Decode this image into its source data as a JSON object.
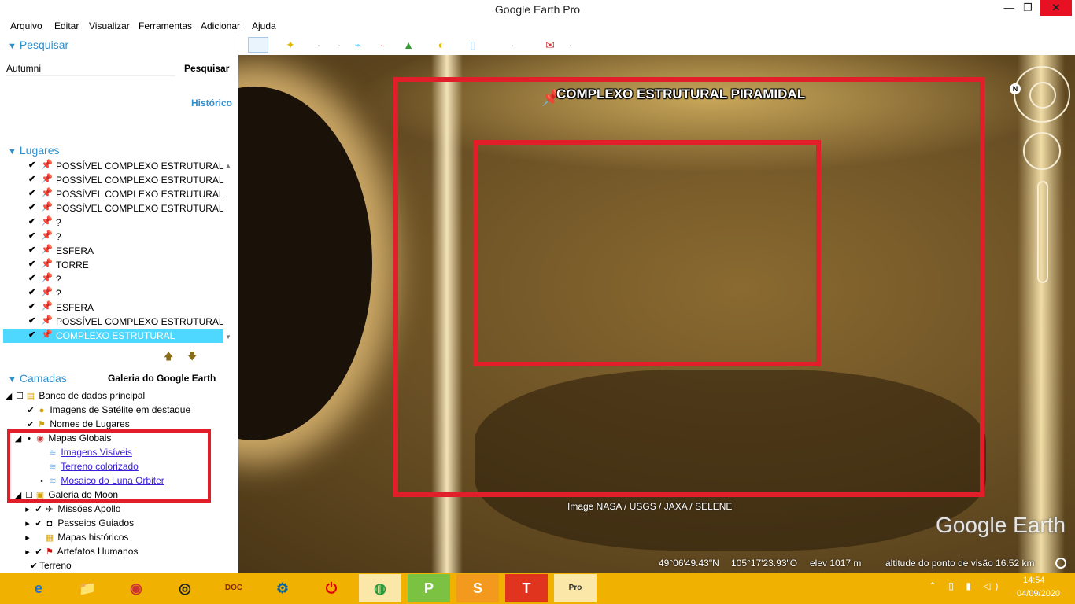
{
  "window": {
    "title": "Google Earth Pro",
    "min": "—",
    "max": "❐",
    "close": "✕"
  },
  "menu": [
    "Arquivo",
    "Editar",
    "Visualizar",
    "Ferramentas",
    "Adicionar",
    "Ajuda"
  ],
  "search": {
    "header": "Pesquisar",
    "input_value": "Autumni",
    "button_label": "Pesquisar",
    "history_label": "Histórico"
  },
  "places": {
    "header": "Lugares",
    "items": [
      "POSSÍVEL COMPLEXO ESTRUTURAL",
      "POSSÍVEL COMPLEXO ESTRUTURAL",
      "POSSÍVEL COMPLEXO ESTRUTURAL",
      "POSSÍVEL COMPLEXO ESTRUTURAL",
      "?",
      "?",
      "ESFERA",
      "TORRE",
      "?",
      "?",
      "ESFERA",
      "POSSÍVEL COMPLEXO ESTRUTURAL",
      "COMPLEXO ESTRUTURAL PIRAMIDAL"
    ],
    "selected_index": 12
  },
  "layers": {
    "header": "Camadas",
    "gallery_button": "Galeria do Google Earth",
    "items": [
      "Banco de dados principal",
      "Imagens de Satélite em destaque",
      "Nomes de Lugares",
      "Mapas Globais",
      "Imagens Visíveis",
      "Terreno colorizado",
      "Mosaico do Luna Orbiter",
      "Galeria do Moon",
      "Missões Apollo",
      "Passeios Guiados",
      "Mapas históricos",
      "Artefatos Humanos",
      "Terreno"
    ]
  },
  "map": {
    "placemark_label": "COMPLEXO ESTRUTURAL PIRAMIDAL",
    "attribution": "Image NASA / USGS / JAXA / SELENE",
    "logo": "Google Earth",
    "north_label": "N",
    "annotation_color": "#e21e2b"
  },
  "status": {
    "lat": "49°06'49.43\"N",
    "lon": "105°17'23.93\"O",
    "elev": "elev  1017 m",
    "altitude": "altitude do ponto de visão  16.52 km"
  },
  "taskbar": {
    "apps": [
      "e",
      "📁",
      "◉",
      "◎",
      "DOC",
      "⚙",
      "⏻",
      "◍",
      "P",
      "S",
      "T",
      "Pro"
    ],
    "active_index": 11,
    "time": "14:54",
    "date": "04/09/2020",
    "tray": "⌃ ▯ ▮ ◁)"
  }
}
